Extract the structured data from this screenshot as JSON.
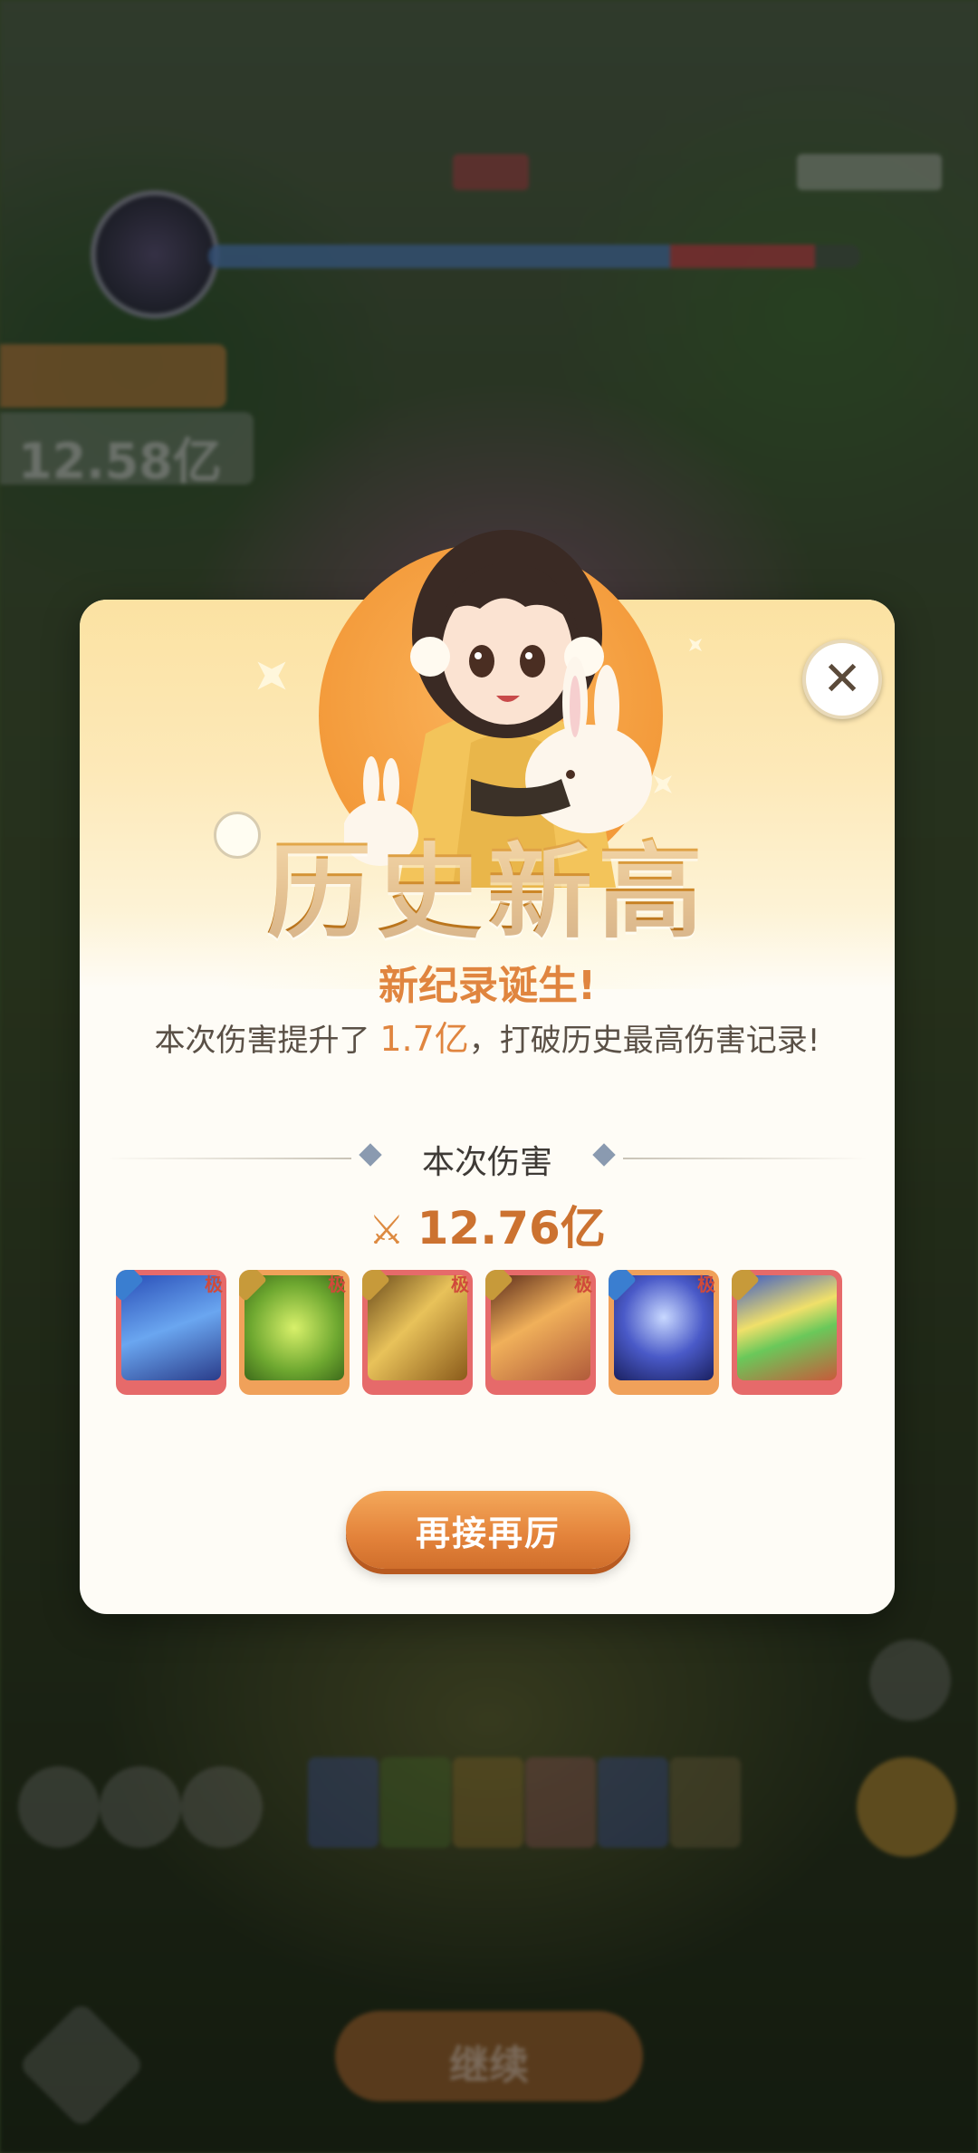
{
  "background": {
    "hud_damage_value": "12.58亿",
    "bottom_button_label": "继续"
  },
  "modal": {
    "title": "历史新高",
    "subtitle": "新纪录诞生!",
    "description_prefix": "本次伤害提升了 ",
    "description_highlight": "1.7亿",
    "description_suffix": "，打破历史最高伤害记录!",
    "section_label": "本次伤害",
    "damage_value": "12.76亿",
    "close_icon": "close-icon",
    "confirm_button_label": "再接再厉"
  },
  "cards": [
    {
      "name": "skill-card-1",
      "badge": "water",
      "level": "极",
      "frame": "#e66a6a"
    },
    {
      "name": "skill-card-2",
      "badge": "sword",
      "level": "极",
      "frame": "#f0a15a"
    },
    {
      "name": "skill-card-3",
      "badge": "sword",
      "level": "极",
      "frame": "#e66a6a"
    },
    {
      "name": "skill-card-4",
      "badge": "sword",
      "level": "极",
      "frame": "#e66a6a"
    },
    {
      "name": "skill-card-5",
      "badge": "water",
      "level": "极",
      "frame": "#f0a15a"
    },
    {
      "name": "skill-card-6",
      "badge": "sword",
      "level": "",
      "frame": "#e66a6a"
    }
  ],
  "colors": {
    "accent": "#e0853f",
    "title_gold": "#c98324"
  }
}
